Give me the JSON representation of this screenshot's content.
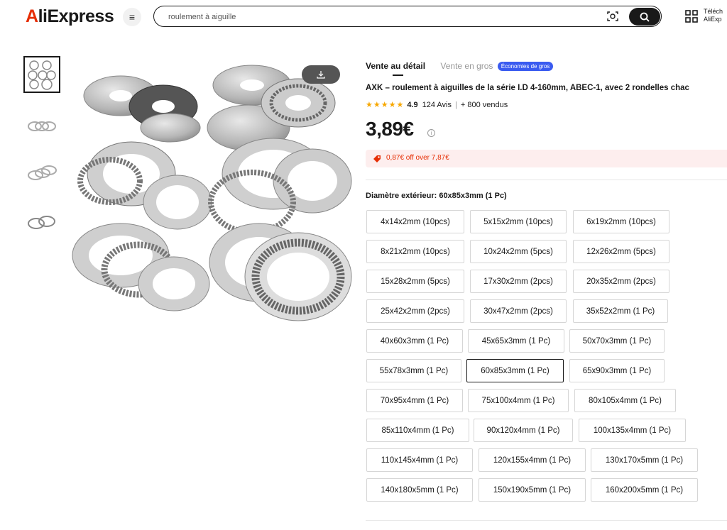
{
  "header": {
    "logo": "AliExpress",
    "search_value": "roulement à aiguille",
    "app_line1": "Téléch",
    "app_line2": "AliExp"
  },
  "gallery": {
    "download_icon": "download-icon"
  },
  "tabs": {
    "retail": "Vente au détail",
    "wholesale": "Vente en gros",
    "badge": "Économies de gros"
  },
  "product": {
    "title": "AXK – roulement à aiguilles de la série I.D 4-160mm, ABEC-1, avec 2 rondelles chac",
    "stars": "★★★★★",
    "rating": "4.9",
    "reviews": "124 Avis",
    "sold": "+ 800 vendus",
    "price": "3,89€",
    "promo": "0,87€ off over 7,87€"
  },
  "options": {
    "label": "Diamètre extérieur: 60x85x3mm (1 Pc)",
    "items": [
      "4x14x2mm (10pcs)",
      "5x15x2mm (10pcs)",
      "6x19x2mm (10pcs)",
      "8x21x2mm (10pcs)",
      "10x24x2mm (5pcs)",
      "12x26x2mm (5pcs)",
      "15x28x2mm (5pcs)",
      "17x30x2mm (2pcs)",
      "20x35x2mm (2pcs)",
      "25x42x2mm (2pcs)",
      "30x47x2mm (2pcs)",
      "35x52x2mm (1 Pc)",
      "40x60x3mm (1 Pc)",
      "45x65x3mm (1 Pc)",
      "50x70x3mm (1 Pc)",
      "55x78x3mm (1 Pc)",
      "60x85x3mm (1 Pc)",
      "65x90x3mm (1 Pc)",
      "70x95x4mm (1 Pc)",
      "75x100x4mm (1 Pc)",
      "80x105x4mm (1 Pc)",
      "85x110x4mm (1 Pc)",
      "90x120x4mm (1 Pc)",
      "100x135x4mm (1 Pc)",
      "110x145x4mm (1 Pc)",
      "120x155x4mm (1 Pc)",
      "130x170x5mm (1 Pc)",
      "140x180x5mm (1 Pc)",
      "150x190x5mm (1 Pc)",
      "160x200x5mm (1 Pc)"
    ],
    "selected": "60x85x3mm (1 Pc)"
  }
}
